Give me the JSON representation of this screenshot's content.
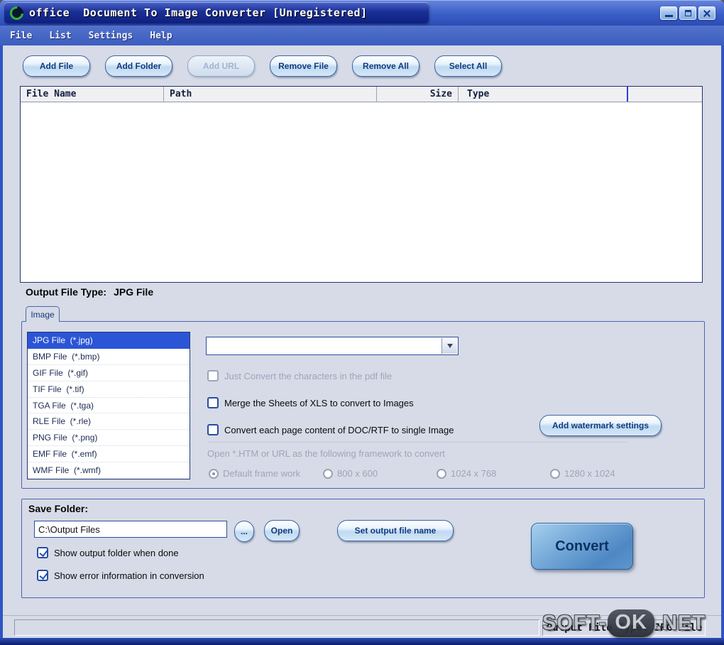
{
  "window": {
    "title": "office  Document To Image Converter [Unregistered]"
  },
  "menubar": {
    "items": [
      "File",
      "List",
      "Settings",
      "Help"
    ]
  },
  "toolbar": {
    "add_file": "Add File",
    "add_folder": "Add Folder",
    "add_url": "Add URL",
    "remove_file": "Remove File",
    "remove_all": "Remove All",
    "select_all": "Select All"
  },
  "file_table": {
    "columns": [
      "File Name",
      "Path",
      "Size",
      "Type"
    ]
  },
  "output_type": {
    "label": "Output File Type:",
    "value": "JPG File"
  },
  "tab": {
    "image": "Image"
  },
  "format_list": {
    "selected": "JPG File  (*.jpg)",
    "items": [
      "JPG File  (*.jpg)",
      "BMP File  (*.bmp)",
      "GIF File  (*.gif)",
      "TIF File  (*.tif)",
      "TGA File  (*.tga)",
      "RLE File  (*.rle)",
      "PNG File  (*.png)",
      "EMF File  (*.emf)",
      "WMF File  (*.wmf)"
    ]
  },
  "options": {
    "combo_value": "",
    "checkbox_pdf": "Just Convert the characters in the pdf file",
    "checkbox_xls": "Merge the Sheets of XLS to convert to Images",
    "checkbox_doc": "Convert each page content of DOC/RTF to single Image",
    "watermark_button": "Add watermark settings",
    "framework_caption": "Open *.HTM or URL as the following framework to convert",
    "radio_default": "Default frame work",
    "radio_800": "800 x 600",
    "radio_1024": "1024 x 768",
    "radio_1280": "1280 x 1024"
  },
  "save": {
    "legend": "Save Folder:",
    "path": "C:\\Output Files",
    "browse": "...",
    "open": "Open",
    "set_output": "Set output file name",
    "convert": "Convert",
    "checkbox_folder": "Show output folder when done",
    "checkbox_error": "Show error information in conversion"
  },
  "statusbar": {
    "text": "Output File Type: JPG File"
  },
  "watermark": {
    "left": "SOFT-",
    "mid": "OK",
    "right": ".NET"
  },
  "colors": {
    "titlebar": "#2c4cb4",
    "selection": "#2b55d6",
    "content_bg": "#d7dbe7",
    "convert_button": "#5e96cc"
  }
}
